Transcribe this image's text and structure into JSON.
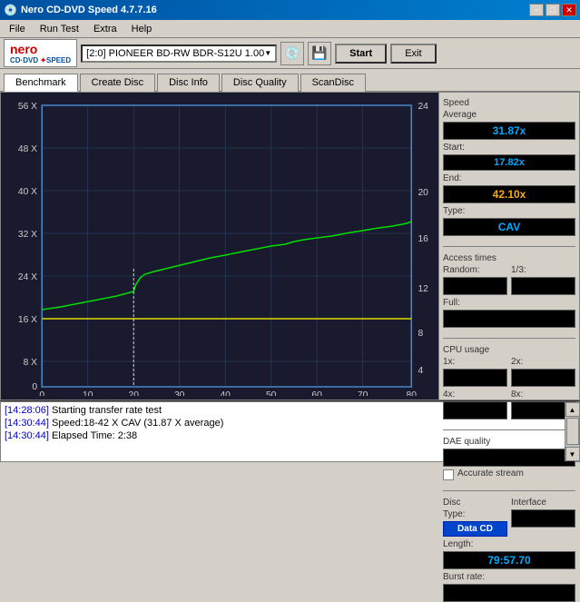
{
  "window": {
    "title": "Nero CD-DVD Speed 4.7.7.16",
    "min_label": "−",
    "max_label": "□",
    "close_label": "✕"
  },
  "menu": {
    "items": [
      "File",
      "Run Test",
      "Extra",
      "Help"
    ]
  },
  "toolbar": {
    "drive_selector": "[2:0]  PIONEER BD-RW   BDR-S12U 1.00",
    "start_label": "Start",
    "exit_label": "Exit"
  },
  "tabs": [
    "Benchmark",
    "Create Disc",
    "Disc Info",
    "Disc Quality",
    "ScanDisc"
  ],
  "active_tab": 0,
  "speed_panel": {
    "title": "Speed",
    "average_label": "Average",
    "average_value": "31.87x",
    "start_label": "Start:",
    "start_value": "17.82x",
    "end_label": "End:",
    "end_value": "42.10x",
    "type_label": "Type:",
    "type_value": "CAV"
  },
  "access_times": {
    "title": "Access times",
    "random_label": "Random:",
    "random_value": "",
    "onethird_label": "1/3:",
    "onethird_value": "",
    "full_label": "Full:",
    "full_value": ""
  },
  "cpu_usage": {
    "title": "CPU usage",
    "x1_label": "1x:",
    "x1_value": "",
    "x2_label": "2x:",
    "x2_value": "",
    "x4_label": "4x:",
    "x4_value": "",
    "x8_label": "8x:",
    "x8_value": ""
  },
  "dae_quality": {
    "title": "DAE quality",
    "value": "",
    "accurate_stream_label": "Accurate stream",
    "accurate_stream_checked": false
  },
  "disc_info": {
    "type_label": "Disc Type:",
    "type_value": "Data CD",
    "length_label": "Length:",
    "length_value": "79:57.70",
    "burst_label": "Burst rate:"
  },
  "interface_label": "Interface",
  "interface_value": "",
  "chart": {
    "y_left_labels": [
      "56 X",
      "48 X",
      "40 X",
      "32 X",
      "24 X",
      "16 X",
      "8 X",
      "0"
    ],
    "y_right_labels": [
      "24",
      "20",
      "16",
      "12",
      "8",
      "4"
    ],
    "x_labels": [
      "0",
      "10",
      "20",
      "30",
      "40",
      "50",
      "60",
      "70",
      "80"
    ]
  },
  "log": {
    "lines": [
      {
        "time": "[14:28:06]",
        "text": " Starting transfer rate test"
      },
      {
        "time": "[14:30:44]",
        "text": " Speed:18-42 X CAV (31.87 X average)"
      },
      {
        "time": "[14:30:44]",
        "text": " Elapsed Time: 2:38"
      }
    ]
  }
}
